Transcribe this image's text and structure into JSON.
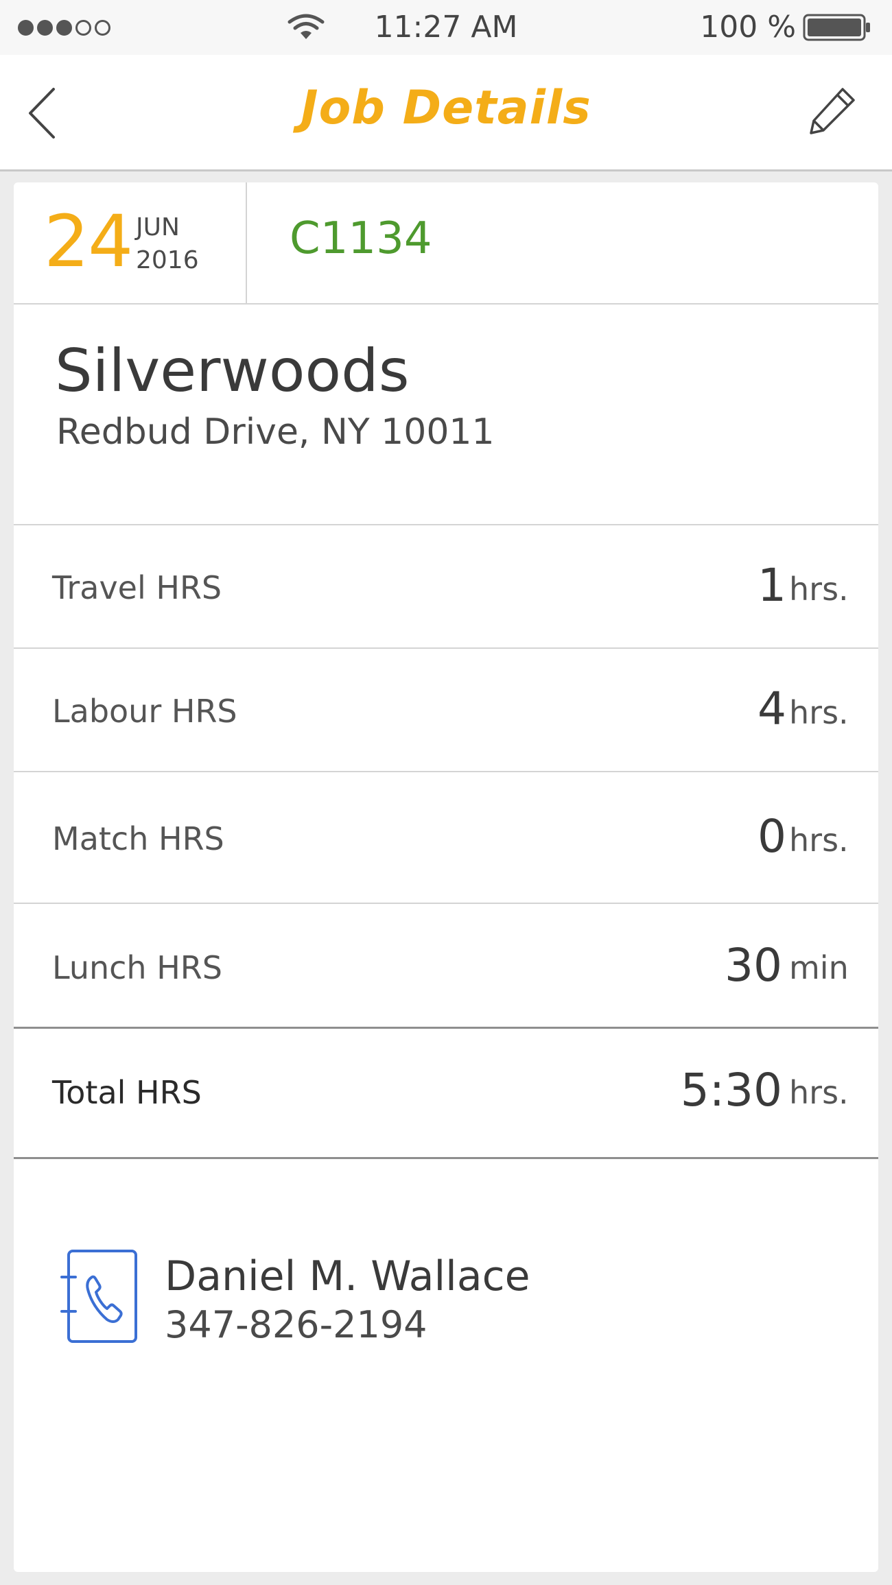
{
  "status_bar": {
    "signal_bars": 3,
    "signal_total": 5,
    "time": "11:27 AM",
    "battery_text": "100 %",
    "battery_level": 1.0,
    "icons": [
      "wifi-icon",
      "battery-icon"
    ]
  },
  "nav": {
    "title": "Job Details",
    "back_icon": "chevron-left-icon",
    "edit_icon": "pencil-icon",
    "title_color": "#f4ad18"
  },
  "job": {
    "day": "24",
    "month": "JUN",
    "year": "2016",
    "code": "C1134",
    "code_color": "#4e9a2e"
  },
  "location": {
    "name": "Silverwoods",
    "address": "Redbud Drive, NY 10011"
  },
  "hours": [
    {
      "label": "Travel HRS",
      "value": "1",
      "unit": "hrs."
    },
    {
      "label": "Labour HRS",
      "value": "4",
      "unit": "hrs."
    },
    {
      "label": "Match HRS",
      "value": "0",
      "unit": "hrs."
    },
    {
      "label": "Lunch HRS",
      "value": "30",
      "unit": "min"
    }
  ],
  "total": {
    "label": "Total HRS",
    "value": "5:30",
    "unit": "hrs."
  },
  "contact": {
    "name": "Daniel M. Wallace",
    "phone": "347-826-2194",
    "icon": "phone-book-icon",
    "icon_color": "#3b6fd4"
  }
}
